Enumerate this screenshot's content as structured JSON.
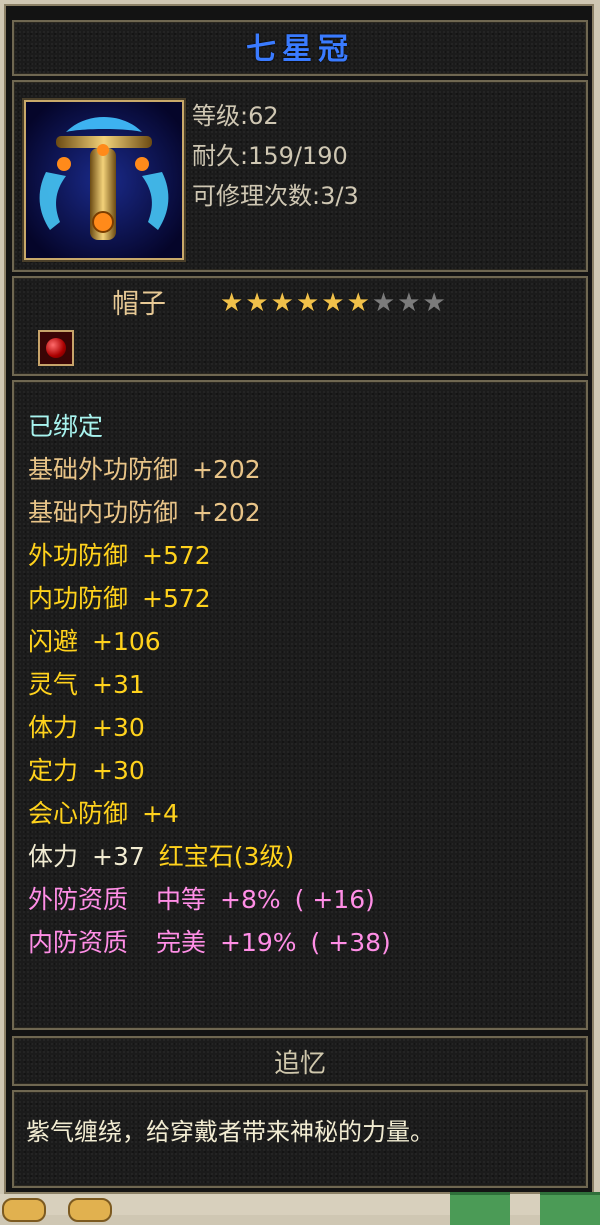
{
  "item": {
    "name": "七星冠",
    "stats": [
      "等级:62",
      "耐久:159/190",
      "可修理次数:3/3"
    ],
    "type": "帽子",
    "stars": {
      "filled": 6,
      "total": 9
    },
    "attributes": [
      {
        "text": "已绑定",
        "color": "#a8f4ef"
      },
      {
        "label": "基础外功防御",
        "value": "+202",
        "color": "#e8c488"
      },
      {
        "label": "基础内功防御",
        "value": "+202",
        "color": "#e8c488"
      },
      {
        "label": "外功防御",
        "value": "+572",
        "color": "#ffd21c"
      },
      {
        "label": "内功防御",
        "value": "+572",
        "color": "#ffd21c"
      },
      {
        "label": "闪避",
        "value": "+106",
        "color": "#ffd21c"
      },
      {
        "label": "灵气",
        "value": "+31",
        "color": "#ffd21c"
      },
      {
        "label": "体力",
        "value": "+30",
        "color": "#ffd21c"
      },
      {
        "label": "定力",
        "value": "+30",
        "color": "#ffd21c"
      },
      {
        "label": "会心防御",
        "value": "+4",
        "color": "#ffd21c"
      },
      {
        "label": "体力",
        "value": "+37",
        "color": "#f2ecd2",
        "gem": "红宝石(3级)"
      },
      {
        "label": "外防资质",
        "grade": "中等",
        "value": "+8%",
        "extra": "( +16)",
        "color": "#ff8ee6"
      },
      {
        "label": "内防资质",
        "grade": "完美",
        "value": "+19%",
        "extra": "( +38)",
        "color": "#ff8ee6"
      }
    ],
    "memory_title": "追忆",
    "description": "紫气缠绕，给穿戴者带来神秘的力量。"
  },
  "colors": {
    "title": "#3a7bff",
    "border": "#6f6751",
    "frame_border": "#8b8066"
  }
}
